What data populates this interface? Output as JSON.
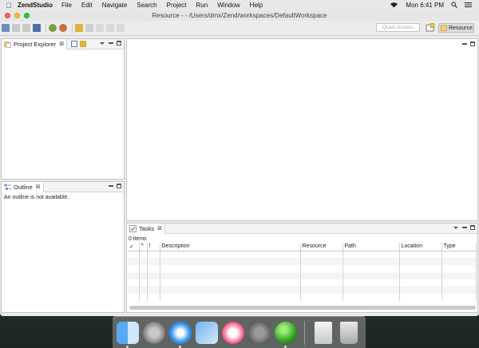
{
  "menubar": {
    "app_name": "ZendStudio",
    "menus": [
      "File",
      "Edit",
      "Navigate",
      "Search",
      "Project",
      "Run",
      "Window",
      "Help"
    ],
    "clock": "Mon 6:41 PM"
  },
  "window": {
    "title": "Resource - - /Users/dmx/Zend/workspaces/DefaultWorkspace"
  },
  "toolbar": {
    "quick_access_placeholder": "Quick Access",
    "perspective_label": "Resource"
  },
  "project_explorer": {
    "tab_label": "Project Explorer",
    "close_glyph": "⊠"
  },
  "outline": {
    "tab_label": "Outline",
    "close_glyph": "⊠",
    "message": "An outline is not available."
  },
  "tasks": {
    "tab_label": "Tasks",
    "close_glyph": "⊠",
    "count": "0 items",
    "columns": [
      "✓",
      "^",
      "!",
      "Description",
      "Resource",
      "Path",
      "Location",
      "Type"
    ]
  },
  "dock": {
    "apps": [
      "finder-icon",
      "launchpad-icon",
      "safari-icon",
      "mail-icon",
      "itunes-icon",
      "system-preferences-icon",
      "zend-studio-icon",
      "documents-stack-icon",
      "trash-icon"
    ]
  },
  "colors": {
    "menubar_bg": "#e8e8e8",
    "window_bg": "#ececec",
    "close": "#fc5f57",
    "minimize": "#fdbc2e",
    "maximize": "#28c940"
  }
}
